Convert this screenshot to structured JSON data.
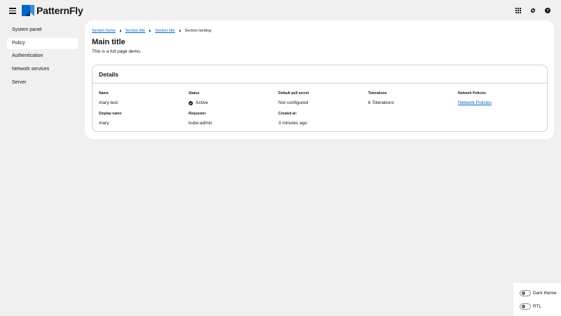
{
  "header": {
    "brand": "PatternFly",
    "icons": [
      "apps-grid-icon",
      "gear-icon",
      "help-icon"
    ]
  },
  "sidebar": {
    "items": [
      {
        "label": "System panel",
        "active": false
      },
      {
        "label": "Policy",
        "active": true
      },
      {
        "label": "Authentication",
        "active": false
      },
      {
        "label": "Network services",
        "active": false
      },
      {
        "label": "Server",
        "active": false
      }
    ]
  },
  "breadcrumb": {
    "items": [
      {
        "label": "Section home"
      },
      {
        "label": "Section title"
      },
      {
        "label": "Section title"
      },
      {
        "label": "Section landing"
      }
    ]
  },
  "page": {
    "title": "Main title",
    "description": "This is a full page demo."
  },
  "details": {
    "title": "Details",
    "fields": {
      "name": {
        "label": "Name",
        "value": "mary-test"
      },
      "status": {
        "label": "Status",
        "value": "Active"
      },
      "pull_secret": {
        "label": "Default pull secret",
        "value": "Not configured"
      },
      "tolerations": {
        "label": "Tolerations",
        "value": "6 Tolerations"
      },
      "network_policies": {
        "label": "Network Policies",
        "value": "Network Policies"
      },
      "display_name": {
        "label": "Display name",
        "value": "mary"
      },
      "requester": {
        "label": "Requester",
        "value": "kube:admin"
      },
      "created": {
        "label": "Created at:",
        "value": "3 minutes ago"
      }
    }
  },
  "toggles": {
    "dark_theme": {
      "label": "Dark theme",
      "on": false
    },
    "rtl": {
      "label": "RTL",
      "on": false
    }
  },
  "colors": {
    "link": "#0066cc",
    "page_bg": "#f0f0f0",
    "border": "#d2d2d2"
  }
}
